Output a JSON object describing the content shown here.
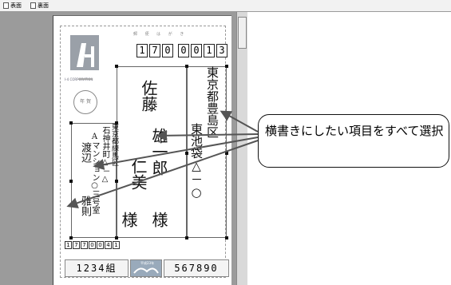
{
  "tabs": [
    {
      "label": "表面"
    },
    {
      "label": "裏面"
    }
  ],
  "postcard": {
    "header": "郵 便 は が き",
    "logo_caption": "I-4 CORPORATION",
    "stamp_label": "年 賀",
    "recipient_zip": [
      "1",
      "7",
      "0",
      "0",
      "0",
      "1",
      "3"
    ],
    "recipient_address_1": "東京都豊島区",
    "recipient_address_2": "東池袋△－○",
    "recipient_name_1": "佐藤",
    "recipient_name_2": "雄一郎",
    "recipient_name_3": "仁美",
    "honorific_1": "様",
    "honorific_2": "様",
    "sender_address_1": "東京都練馬区",
    "sender_address_2": "石神井町△－△",
    "sender_address_3": "Aマンション○三号室",
    "sender_name_1": "渡辺",
    "sender_name_2": "雅則",
    "sender_zip": [
      "1",
      "7",
      "7",
      "0",
      "0",
      "4",
      "1"
    ],
    "lottery_left": "1234組",
    "lottery_center": "平成23年",
    "lottery_right": "567890"
  },
  "callout": {
    "text": "横書きにしたい項目をすべて選択"
  }
}
